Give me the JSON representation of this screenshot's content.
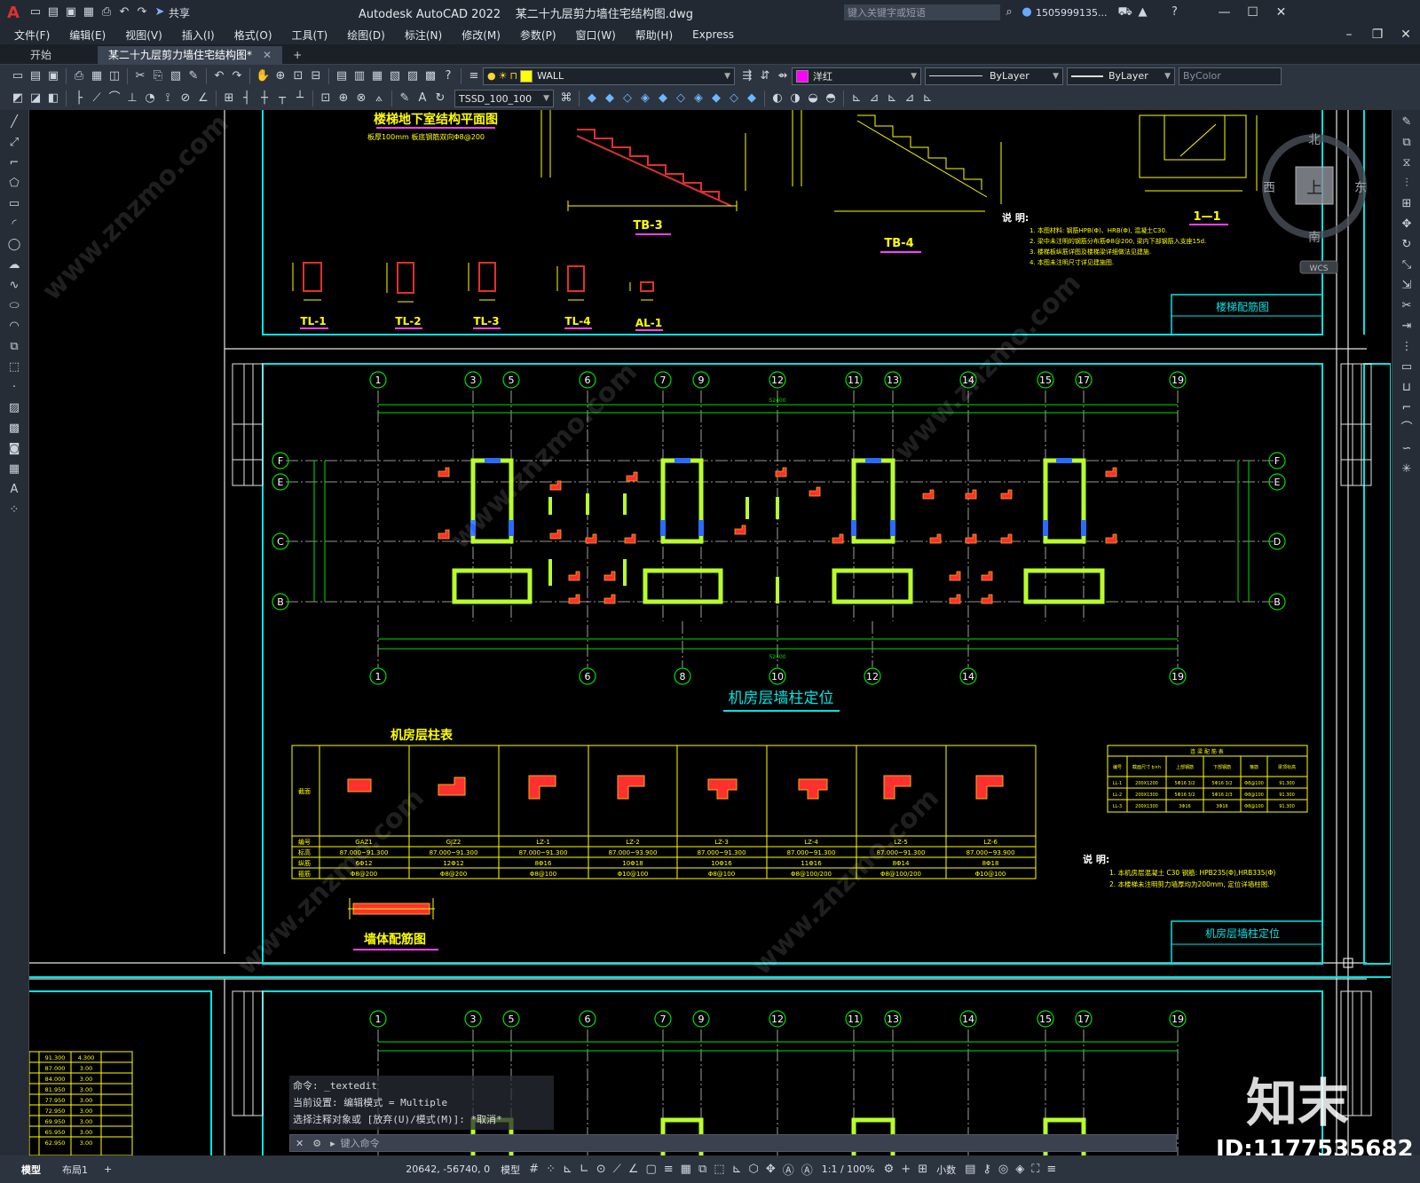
{
  "titlebar": {
    "app_icon": "A",
    "share_label": "共享",
    "title": "Autodesk AutoCAD 2022    某二十九层剪力墙住宅结构图.dwg",
    "search_placeholder": "键入关键字或短语",
    "user": "1505999135...",
    "icons": [
      "new-icon",
      "open-icon",
      "save-icon",
      "saveas-icon",
      "plot-icon",
      "undo-icon",
      "redo-icon"
    ]
  },
  "menu": [
    "文件(F)",
    "编辑(E)",
    "视图(V)",
    "插入(I)",
    "格式(O)",
    "工具(T)",
    "绘图(D)",
    "标注(N)",
    "修改(M)",
    "参数(P)",
    "窗口(W)",
    "帮助(H)",
    "Express"
  ],
  "tabs": [
    {
      "label": "开始",
      "active": false
    },
    {
      "label": "某二十九层剪力墙住宅结构图*",
      "active": true
    }
  ],
  "toolbar1": {
    "layer": "WALL",
    "layer_color": "#ffff00",
    "color_name": "洋红",
    "color_swatch": "#ff00ff",
    "linetype": "ByLayer",
    "lineweight": "ByLayer",
    "plotstyle": "ByColor"
  },
  "toolbar2": {
    "textstyle": "TSSD_100_100"
  },
  "viewcube": {
    "north": "北",
    "south": "南",
    "east": "东",
    "west": "西",
    "top": "上",
    "wcs": "WCS"
  },
  "drawing": {
    "stair_title": "楼梯地下室结构平面图",
    "stair_sub": "板厚100mm  板底钢筋双向Φ8@200",
    "tb3": "TB-3",
    "tb4": "TB-4",
    "sec11": "1—1",
    "note_title": "说 明:",
    "stair_notes": [
      "1. 本图材料: 钢筋HPB(Φ)、HRB(Φ), 混凝土C30.",
      "2. 梁中未注明的钢筋分布筋Φ8@200, 梁内下部钢筋入支座15d.",
      "3. 楼梯板纵筋详图及楼梯梁详细做法见建施.",
      "4. 本图未注明尺寸详见建施图."
    ],
    "stair_frame_title": "楼梯配筋图",
    "beams": [
      "TL-1",
      "TL-2",
      "TL-3",
      "TL-4",
      "AL-1"
    ],
    "plan_title": "机房层墙柱定位",
    "col_table_title": "机房层柱表",
    "col_table_rows": [
      "截面",
      "编号",
      "标高",
      "纵筋",
      "箍筋"
    ],
    "columns": [
      {
        "id": "GAZ1",
        "elev": "87.000~91.300",
        "rebar": "6Φ12",
        "stirrup": "Φ8@200"
      },
      {
        "id": "GJZ2",
        "elev": "87.000~91.300",
        "rebar": "12Φ12",
        "stirrup": "Φ8@200"
      },
      {
        "id": "LZ-1",
        "elev": "87.000~91.300",
        "rebar": "8Φ16",
        "stirrup": "Φ8@100"
      },
      {
        "id": "LZ-2",
        "elev": "87.000~93.900",
        "rebar": "10Φ18",
        "stirrup": "Φ10@100"
      },
      {
        "id": "LZ-3",
        "elev": "87.000~91.300",
        "rebar": "10Φ16",
        "stirrup": "Φ8@100"
      },
      {
        "id": "LZ-4",
        "elev": "87.000~91.300",
        "rebar": "11Φ16",
        "stirrup": "Φ8@100/200"
      },
      {
        "id": "LZ-5",
        "elev": "87.000~91.300",
        "rebar": "8Φ14",
        "stirrup": "Φ8@100/200"
      },
      {
        "id": "LZ-6",
        "elev": "87.000~93.900",
        "rebar": "8Φ18",
        "stirrup": "Φ10@100"
      }
    ],
    "beam_table_title": "连 梁 配 筋 表",
    "beam_table_head": [
      "编号",
      "截面尺寸 b×h",
      "上部钢筋",
      "下部钢筋",
      "箍筋",
      "梁顶标高"
    ],
    "beam_table_rows": [
      [
        "LL-1",
        "200X1200",
        "5Φ16 3/2",
        "5Φ16 3/2",
        "Φ8@100",
        "91.300"
      ],
      [
        "LL-2",
        "200X1300",
        "5Φ16 3/2",
        "5Φ16 2/3",
        "Φ8@100",
        "91.300"
      ],
      [
        "LL-3",
        "200X1300",
        "3Φ16",
        "3Φ16",
        "Φ8@100",
        "91.300"
      ]
    ],
    "plan_notes": [
      "1. 本机房层混凝土 C30   钢筋: HPB235(Φ),HRB335(Φ)",
      "2. 本楼梯未注明剪力墙厚均为200mm, 定位详墙柱图."
    ],
    "plan_frame_title": "机房层墙柱定位",
    "wall_title": "墙体配筋图",
    "axis_top": [
      "1",
      "3",
      "5",
      "6",
      "7",
      "9",
      "12",
      "11",
      "13",
      "14",
      "15",
      "17",
      "19"
    ],
    "axis_bottom": [
      "1",
      "6",
      "8",
      "10",
      "12",
      "14",
      "19"
    ],
    "axis_left": [
      "F",
      "E",
      "C",
      "B"
    ],
    "axis_right": [
      "F",
      "E",
      "D",
      "B"
    ],
    "total_dim": "52400",
    "elev_table": [
      [
        "91.300",
        "4.300"
      ],
      [
        "87.000",
        "3.00"
      ],
      [
        "84.000",
        "3.00"
      ],
      [
        "81.950",
        "3.00"
      ],
      [
        "77.950",
        "3.00"
      ],
      [
        "72.950",
        "3.00"
      ],
      [
        "69.950",
        "3.00"
      ],
      [
        "65.950",
        "3.00"
      ],
      [
        "62.950",
        "3.00"
      ]
    ]
  },
  "commandline": {
    "lines": [
      "命令: _textedit",
      "当前设置: 编辑模式 = Multiple",
      "选择注释对象或 [放弃(U)/模式(M)]: *取消*"
    ],
    "placeholder": "键入命令"
  },
  "statusbar": {
    "tabs": [
      "模型",
      "布局1"
    ],
    "coords": "20642, -56740, 0",
    "mode": "模型",
    "scale": "1:1 / 100%",
    "units": "小数"
  },
  "watermark": {
    "brand": "知末",
    "id": "ID:1177535682",
    "site": "www.znzmo.com"
  }
}
